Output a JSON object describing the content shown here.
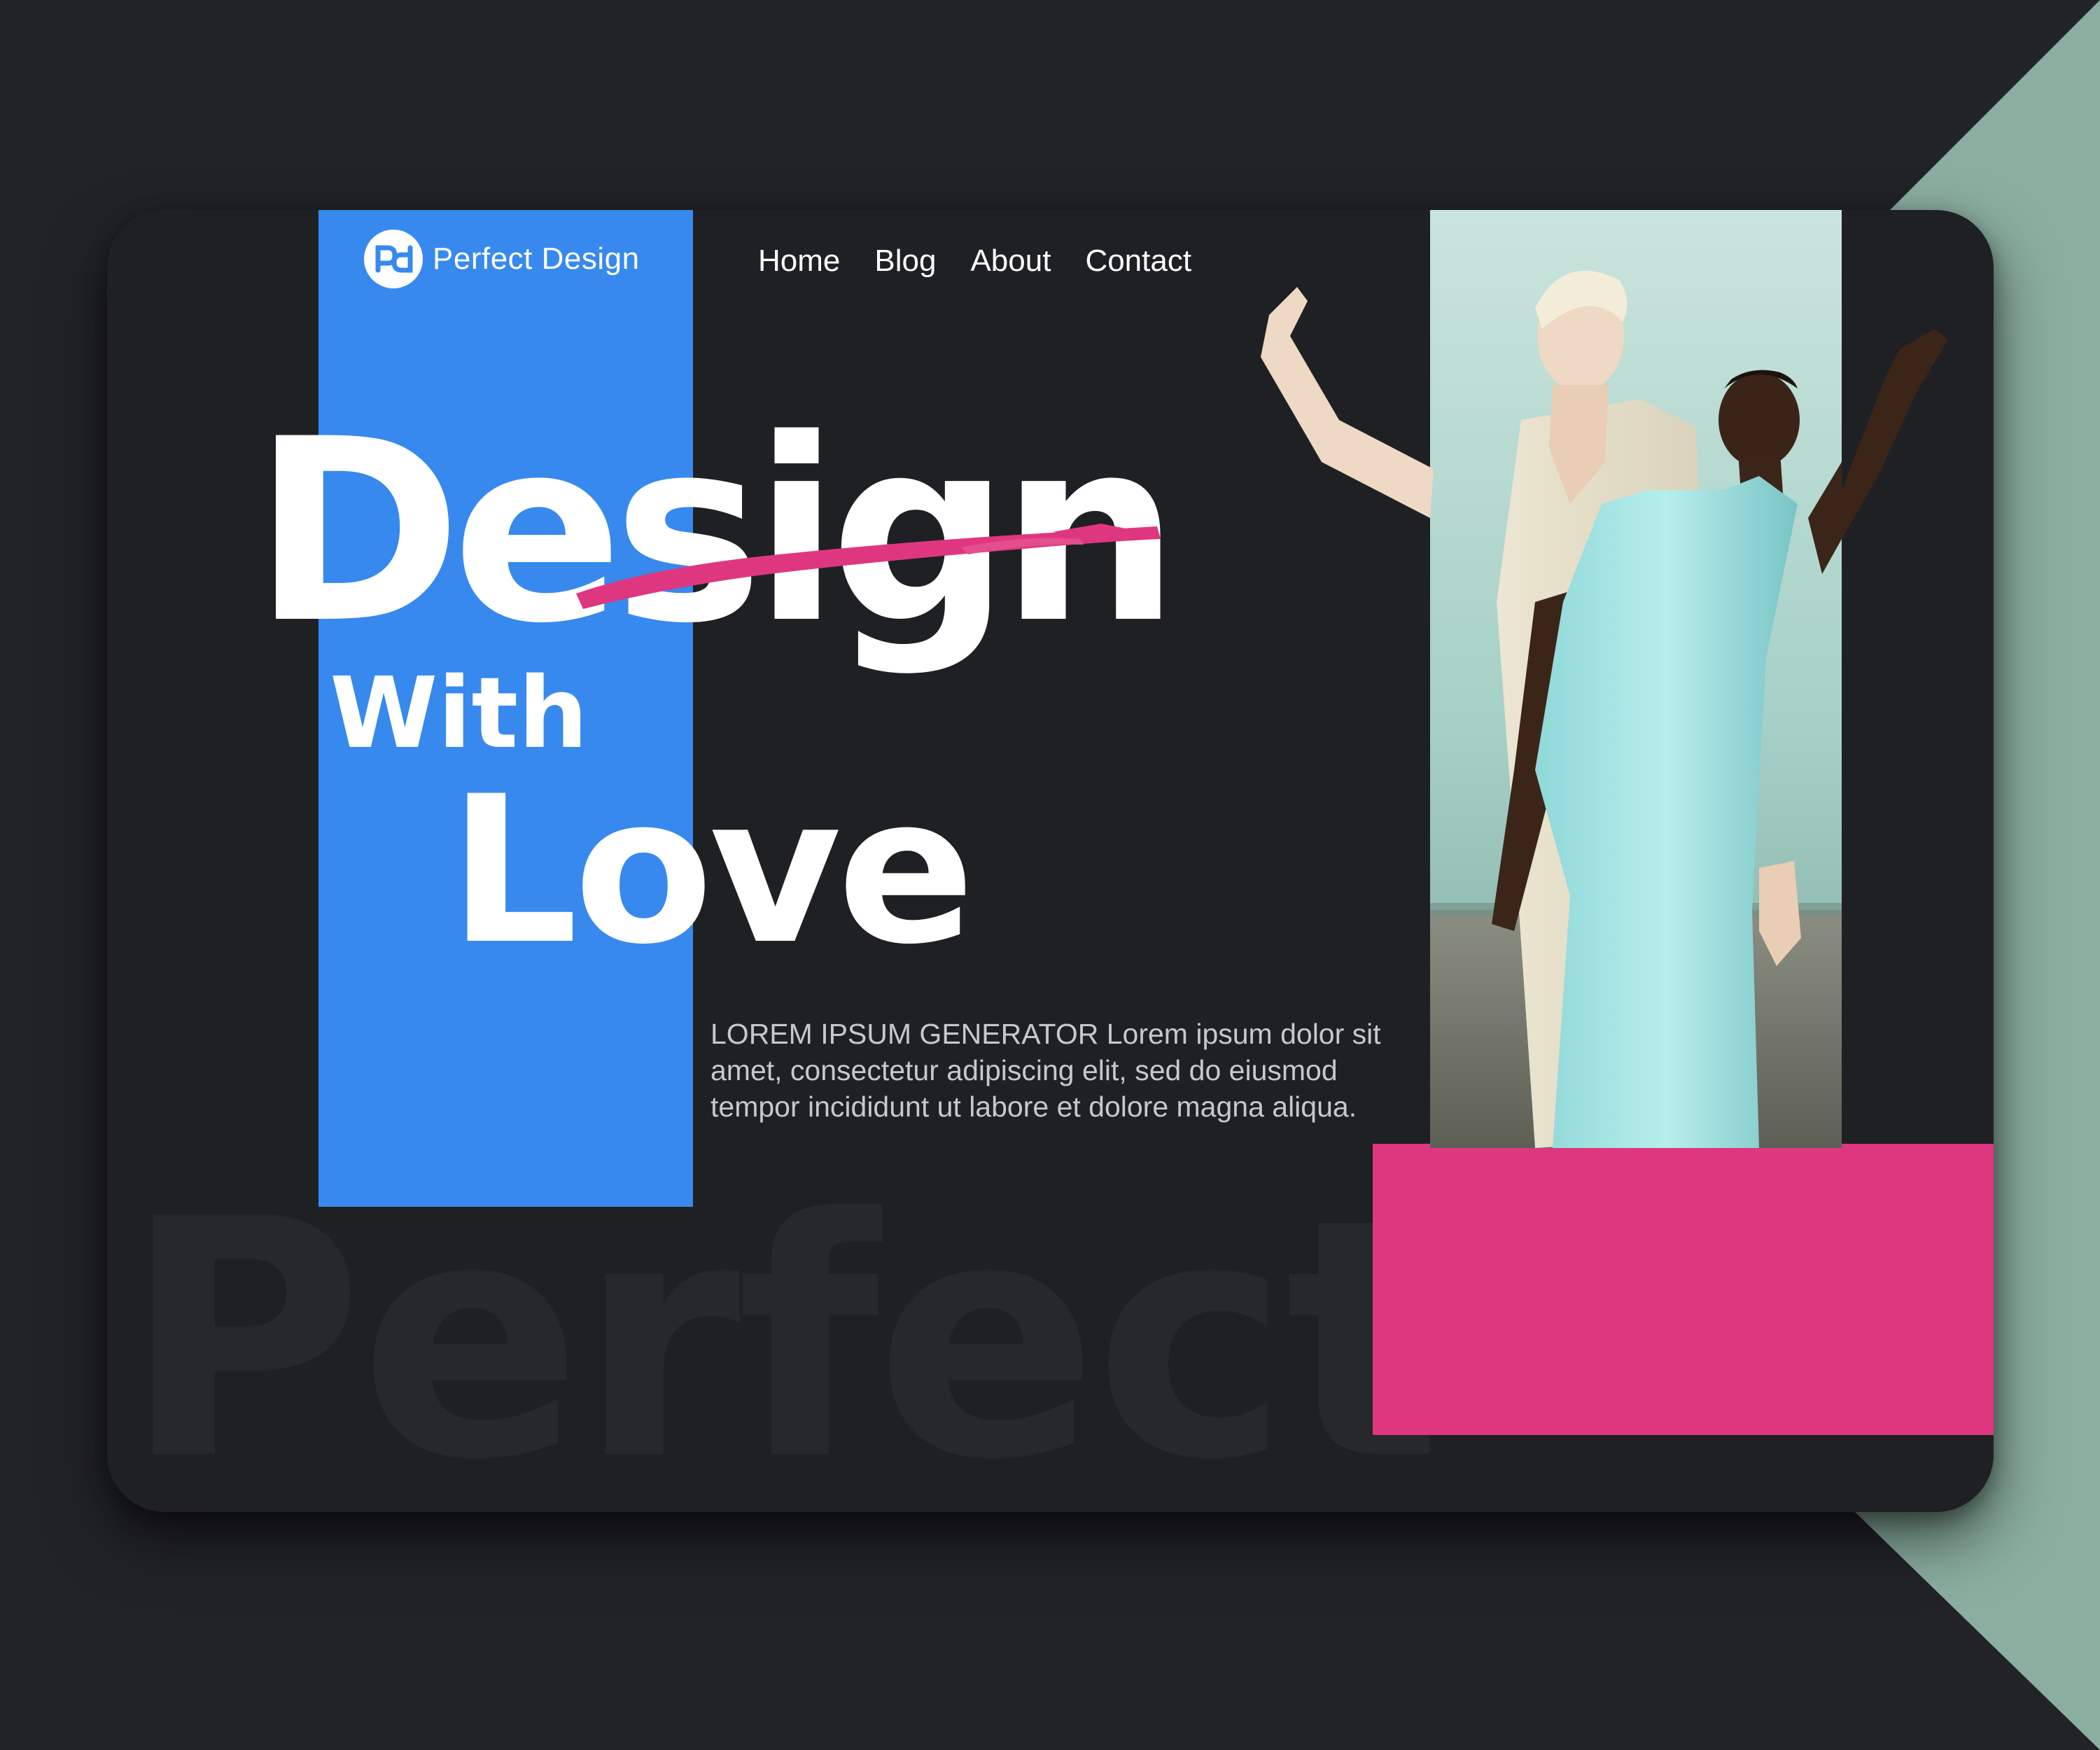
{
  "site": {
    "brand_initials": "pd",
    "brand_name": "Perfect Design"
  },
  "nav": {
    "items": [
      "Home",
      "Blog",
      "About",
      "Contact"
    ]
  },
  "hero": {
    "line1": "Design",
    "line2": "With",
    "line3": "Love",
    "description": " LOREM IPSUM GENERATOR Lorem ipsum dolor sit amet, consectetur adipiscing elit, sed do eiusmod tempor incididunt ut labore et dolore magna aliqua."
  },
  "watermark": "Perfect",
  "colors": {
    "page_background": "#222327",
    "card_background": "#1f2024",
    "accent_blue": "#3789ee",
    "accent_pink": "#df377f",
    "accent_mint": "#8aae9f",
    "text_primary": "#ffffff",
    "text_secondary": "#c7c8cc"
  }
}
